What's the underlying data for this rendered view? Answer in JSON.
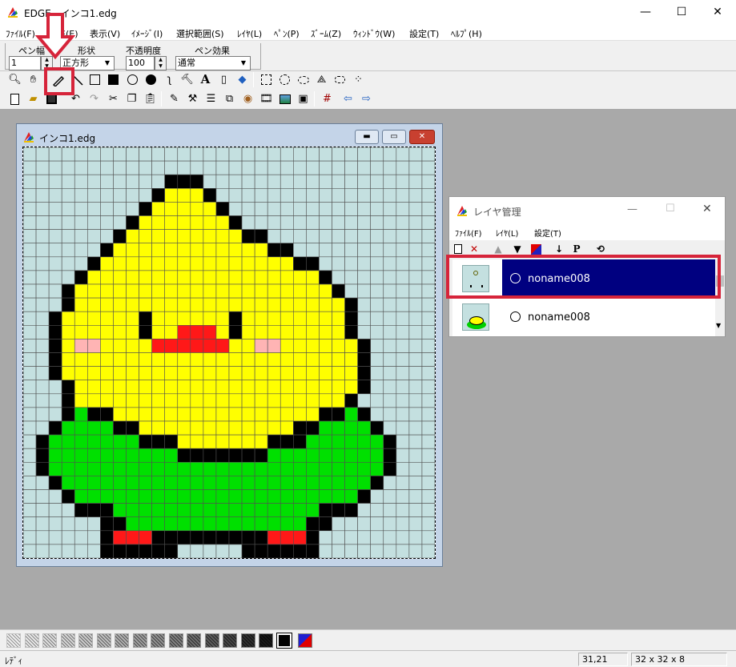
{
  "app": {
    "title": "EDGE - インコ1.edg",
    "window_controls": {
      "minimize": "—",
      "maximize": "☐",
      "close": "✕"
    }
  },
  "menu": [
    "ﾌｧｲﾙ(F)",
    "編集(E)",
    "表示(V)",
    "ｲﾒｰｼﾞ(I)",
    "選択範囲(S)",
    "ﾚｲﾔ(L)",
    "ﾍﾟﾝ(P)",
    "ｽﾞｰﾑ(Z)",
    "ｳｨﾝﾄﾞｳ(W)",
    "設定(T)",
    "ﾍﾙﾌﾟ(H)"
  ],
  "options": {
    "pen_width_label": "ペン幅",
    "pen_width_value": "1",
    "shape_label": "形状",
    "shape_value": "正方形",
    "opacity_label": "不透明度",
    "opacity_value": "100",
    "effect_label": "ペン効果",
    "effect_value": "通常"
  },
  "toolbar1_icons": [
    "magnifier-icon",
    "hand-icon",
    "pen-icon",
    "line-icon",
    "rect-outline-icon",
    "rect-filled-icon",
    "ellipse-outline-icon",
    "ellipse-filled-icon",
    "curve-icon",
    "hammer-icon",
    "text-icon",
    "eraser-icon",
    "fill-bucket-icon",
    "select-rect-icon",
    "select-ellipse-icon",
    "select-lasso-icon",
    "select-polygon-icon",
    "select-color-icon",
    "select-magic-icon"
  ],
  "toolbar2_icons": [
    "new-file-icon",
    "open-folder-icon",
    "save-icon",
    "undo-icon",
    "redo-icon",
    "cut-icon",
    "copy-icon",
    "paste-icon",
    "flip-icon",
    "stamp-icon",
    "grid-lines-icon",
    "transparent-icon",
    "palette-icon",
    "animation-icon",
    "image-icon",
    "frame-icon",
    "grid-icon",
    "prev-icon",
    "next-icon"
  ],
  "image_window": {
    "title": "インコ1.edg",
    "controls": {
      "minimize": "▬",
      "restore": "▭",
      "close": "✕"
    }
  },
  "pixel_art": {
    "cols": 32,
    "rows": 30,
    "palette": {
      ".": "#c4e0e0",
      "B": "#000000",
      "Y": "#ffff00",
      "G": "#00e000",
      "R": "#ff1818",
      "P": "#ffb4b4"
    },
    "grid_color": "#505050",
    "rows_data": [
      "................................",
      "................................",
      "...........BBB..................",
      "..........BYYYB.................",
      ".........BYYYYYB................",
      "........BYYYYYYYB...............",
      ".......BYYYYYYYYYBB.............",
      "......BYYYYYYYYYYYYBB...........",
      ".....BYYYYYYYYYYYYYYYBB.........",
      "....BYYYYYYYYYYYYYYYYYYB........",
      "...BYYYYYYYYYYYYYYYYYYYYB.......",
      "...BYYYYYYYYYYYYYYYYYYYYYB......",
      "..BYYYYYYBYYYYYYBYYYYYYYYB......",
      "..BYYYYYYBYYRRRYBYYYYYYYYB......",
      "..BYPPYYYYRRRRRRYYPPYYYYYYB.....",
      "..BYYYYYYYYYYYYYYYYYYYYYYYB.....",
      "..BYYYYYYYYYYYYYYYYYYYYYYYB.....",
      "...BYYYYYYYYYYYYYYYYYYYYYYB.....",
      "...BYYYYYYYYYYYYYYYYYYYYYB......",
      "...BGBBYYYYYYYYYYYYYYYYBBGB.....",
      "..BGGGGBBYYYYYYYYYYYYBBGGGGB....",
      ".BGGGGGGGBBBYYYYYYYBBBGGGGGGB...",
      ".BGGGGGGGGGGBBBBBBBGGGGGGGGGB...",
      ".BGGGGGGGGGGGGGGGGGGGGGGGGGGB...",
      "..BGGGGGGGGGGGGGGGGGGGGGGGGB....",
      "...BGGGGGGGGGGGGGGGGGGGGGGB.....",
      "....BBBGGGGGGGGGGGGGGGGBBB......",
      "......BBGGGGGGGGGGGGGGBB........",
      "......BRRRBBBBBBBBBRRRB.........",
      "......BBBBBB.....BBBBBB........."
    ]
  },
  "layer_window": {
    "title": "レイヤ管理",
    "menu": [
      "ﾌｧｲﾙ(F)",
      "ﾚｲﾔ(L)",
      "設定(T)"
    ],
    "tool_labels": {
      "move_up": "▲",
      "move_down": "▼",
      "p_label": "P"
    },
    "layers": [
      {
        "name": "noname008",
        "selected": true
      },
      {
        "name": "noname008",
        "selected": false
      }
    ]
  },
  "status": {
    "text": "ﾚﾃﾞｨ",
    "coords": "31,21",
    "size": "32 x 32 x 8"
  },
  "colors": {
    "highlight": "#d6243a",
    "selected_layer": "#000080",
    "workspace": "#a9a9a9"
  }
}
